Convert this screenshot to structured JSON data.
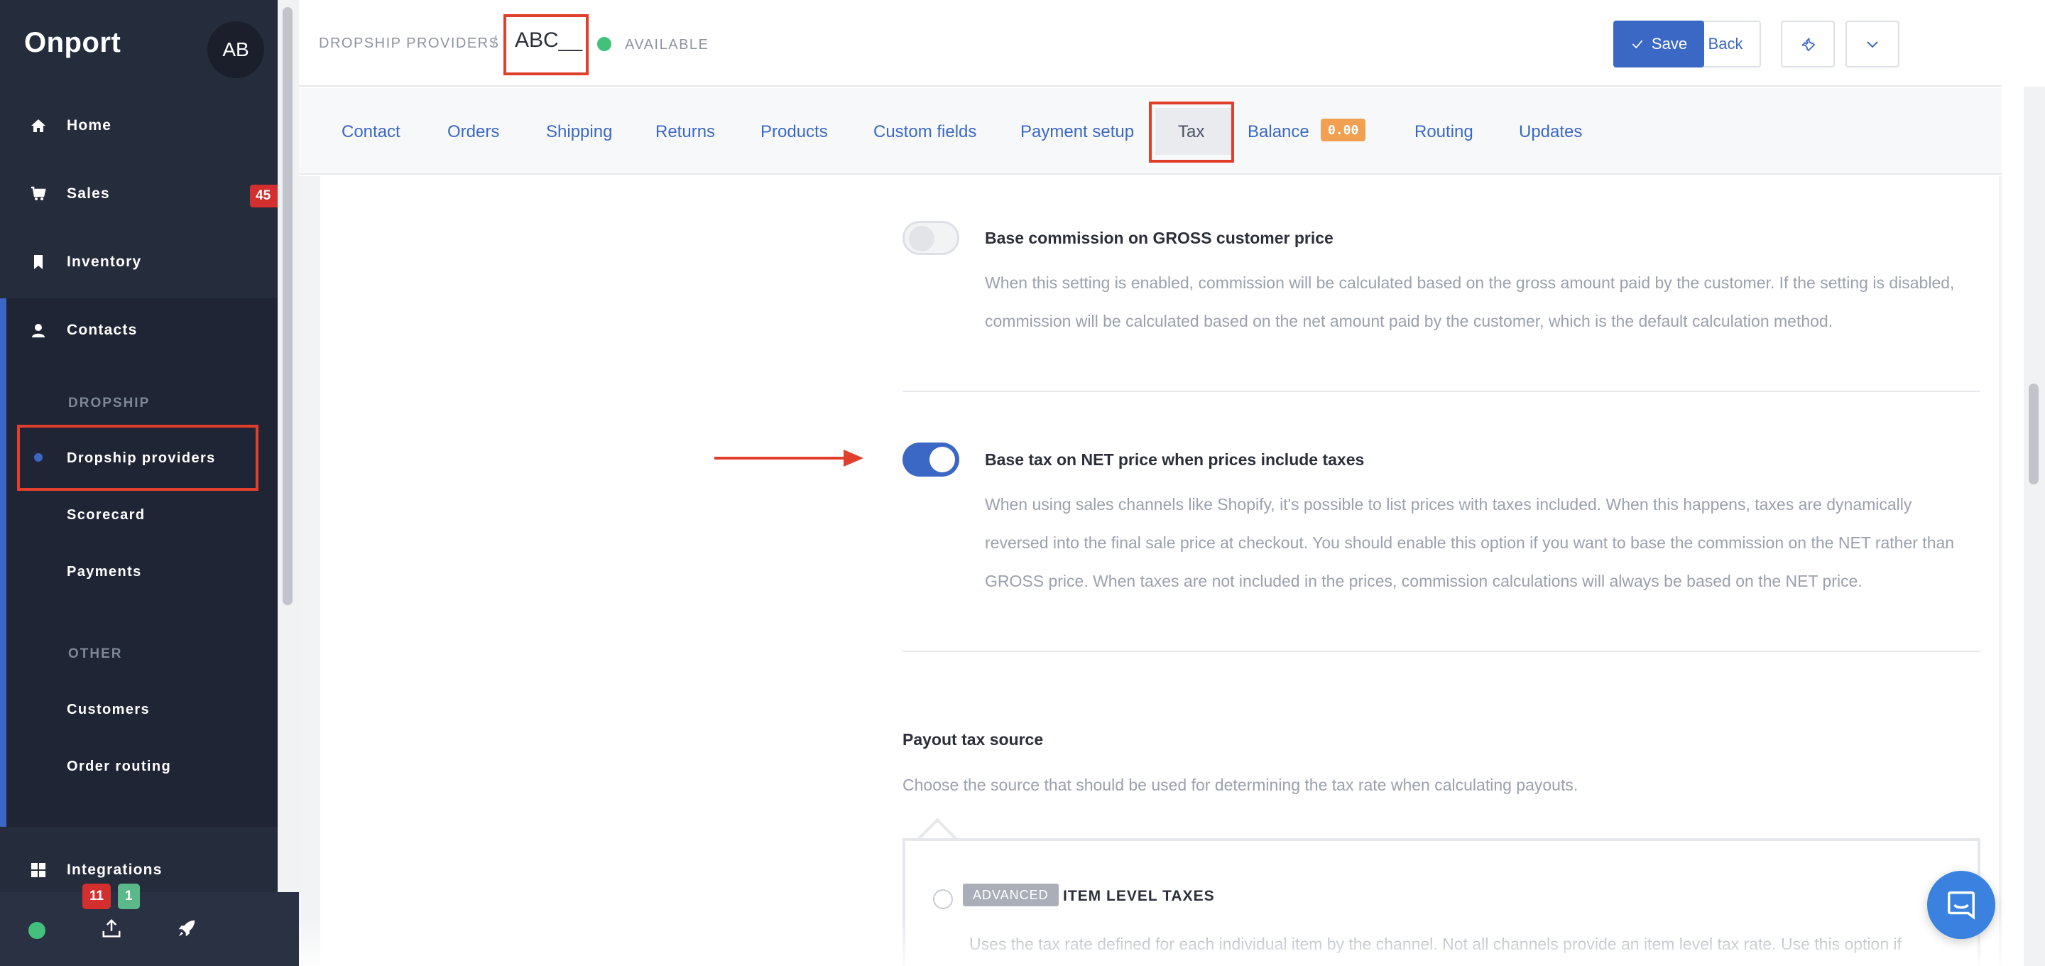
{
  "sidebar": {
    "logo": "Onport",
    "avatar_initials": "AB",
    "nav": {
      "home": "Home",
      "sales": "Sales",
      "sales_badge": "45",
      "inventory": "Inventory",
      "contacts": "Contacts",
      "integrations": "Integrations"
    },
    "section_dropship": "DROPSHIP",
    "dropship_items": [
      "Dropship providers",
      "Scorecard",
      "Payments"
    ],
    "section_other": "OTHER",
    "other_items": [
      "Customers",
      "Order routing"
    ],
    "bottom": {
      "badge_red": "11",
      "badge_green": "1"
    }
  },
  "header": {
    "breadcrumb": "DROPSHIP PROVIDERS",
    "separator": "/",
    "provider_name": "ABC__",
    "status": "AVAILABLE",
    "back_label": "Back",
    "save_label": "Save"
  },
  "tabs": {
    "contact": "Contact",
    "orders": "Orders",
    "shipping": "Shipping",
    "returns": "Returns",
    "products": "Products",
    "custom_fields": "Custom fields",
    "payment_setup": "Payment setup",
    "tax": "Tax",
    "balance": "Balance",
    "balance_value": "0.00",
    "routing": "Routing",
    "updates": "Updates",
    "active": "tax"
  },
  "settings": {
    "gross_commission": {
      "title": "Base commission on GROSS customer price",
      "description": "When this setting is enabled, commission will be calculated based on the gross amount paid by the customer. If the setting is disabled, commission will be calculated based on the net amount paid by the customer, which is the default calculation method.",
      "enabled": false
    },
    "net_tax": {
      "title": "Base tax on NET price when prices include taxes",
      "description": "When using sales channels like Shopify, it's possible to list prices with taxes included. When this happens, taxes are dynamically reversed into the final sale price at checkout. You should enable this option if you want to base the commission on the NET rather than GROSS price. When taxes are not included in the prices, commission calculations will always be based on the NET price.",
      "enabled": true
    }
  },
  "payout_tax_source": {
    "title": "Payout tax source",
    "description": "Choose the source that should be used for determining the tax rate when calculating payouts.",
    "option": {
      "badge": "ADVANCED",
      "title": "ITEM LEVEL TAXES",
      "description": "Uses the tax rate defined for each individual item by the channel. Not all channels provide an item level tax rate. Use this option if"
    }
  },
  "colors": {
    "sidebar_bg": "#252c3c",
    "accent": "#3b68c4",
    "highlight": "#e0402b",
    "status_green": "#43c17c",
    "badge_orange": "#f0a050",
    "badge_red": "#d32f2f"
  }
}
